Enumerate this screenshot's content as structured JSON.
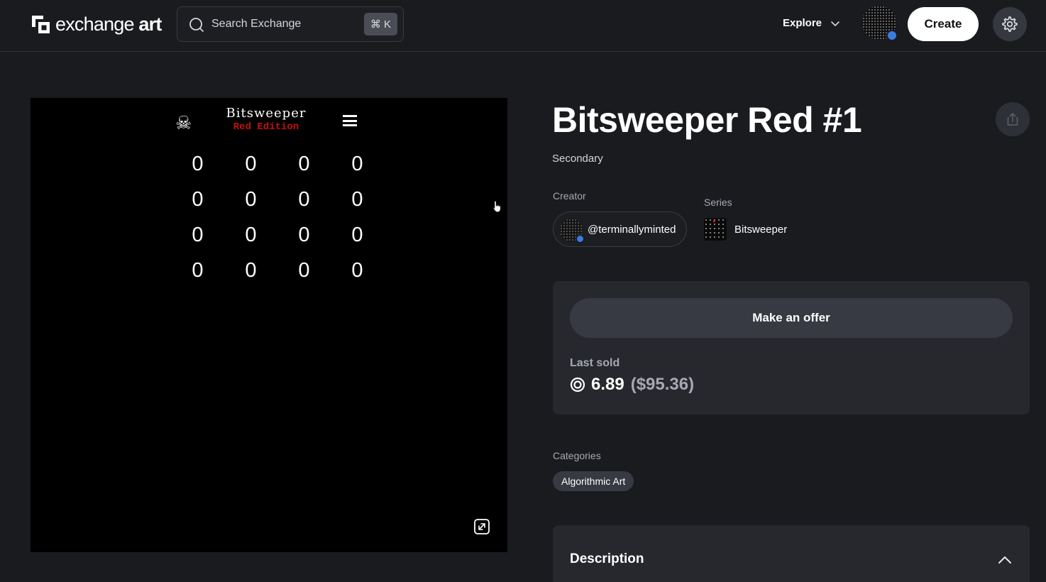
{
  "header": {
    "logo": {
      "word1": "exchange",
      "word2": "art"
    },
    "search": {
      "placeholder": "Search Exchange",
      "shortcut": "⌘ K"
    },
    "explore_label": "Explore",
    "create_label": "Create"
  },
  "artwork": {
    "title": "Bitsweeper",
    "subtitle": "Red Edition",
    "skull_glyph": "☠",
    "grid": [
      [
        "0",
        "0",
        "0",
        "0"
      ],
      [
        "0",
        "0",
        "0",
        "0"
      ],
      [
        "0",
        "0",
        "0",
        "0"
      ],
      [
        "0",
        "0",
        "0",
        "0"
      ]
    ]
  },
  "item": {
    "title": "Bitsweeper Red #1",
    "market": "Secondary",
    "creator_label": "Creator",
    "creator_handle": "@terminallyminted",
    "series_label": "Series",
    "series_name": "Bitsweeper"
  },
  "offer": {
    "button_label": "Make an offer",
    "last_sold_label": "Last sold",
    "price": "6.89",
    "price_usd": "($95.36)"
  },
  "categories": {
    "label": "Categories",
    "tags": [
      "Algorithmic Art"
    ]
  },
  "description": {
    "label": "Description"
  },
  "colors": {
    "background": "#1a1b1f",
    "card": "#26282e",
    "accent_red": "#c31111",
    "verified_badge": "#3b7be0"
  }
}
